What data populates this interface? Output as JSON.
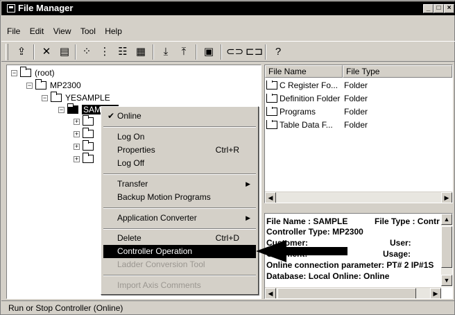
{
  "window": {
    "title": "File Manager"
  },
  "menu": [
    "File",
    "Edit",
    "View",
    "Tool",
    "Help"
  ],
  "toolbar": {
    "tools": [
      {
        "icon": "up-folder-icon"
      },
      {
        "icon": "delete-icon"
      },
      {
        "icon": "properties-icon"
      },
      {
        "icon": "small-icons-icon"
      },
      {
        "icon": "tree-view-icon"
      },
      {
        "icon": "list-view-icon"
      },
      {
        "icon": "details-view-icon"
      },
      {
        "icon": "download-icon"
      },
      {
        "icon": "upload-icon"
      },
      {
        "icon": "save-icon"
      },
      {
        "icon": "connect-icon"
      },
      {
        "icon": "disconnect-icon"
      },
      {
        "icon": "help-icon"
      }
    ]
  },
  "tree": {
    "root": "(root)",
    "controller": "MP2300",
    "project": "YESAMPLE",
    "selected": "SAMPLE"
  },
  "list": {
    "columns": [
      "File Name",
      "File Type"
    ],
    "rows": [
      {
        "name": "C Register Fo...",
        "type": "Folder"
      },
      {
        "name": "Definition Folder",
        "type": "Folder"
      },
      {
        "name": "Programs",
        "type": "Folder"
      },
      {
        "name": "Table Data F...",
        "type": "Folder"
      }
    ]
  },
  "info": {
    "file_name": "File Name : SAMPLE",
    "file_type": "File Type : Contr",
    "controller_type": "Controller Type: MP2300",
    "customer": "Customer:",
    "user": "User:",
    "comment": "Comment:",
    "usage": "Usage:",
    "connection": "Online connection parameter: PT# 2 IP#1S",
    "database": "Database: Local  Online: Online"
  },
  "context_menu": {
    "online": "Online",
    "log_on": "Log On",
    "properties": "Properties",
    "properties_shortcut": "Ctrl+R",
    "log_off": "Log Off",
    "transfer": "Transfer",
    "backup": "Backup Motion Programs",
    "app_converter": "Application Converter",
    "delete": "Delete",
    "delete_shortcut": "Ctrl+D",
    "controller_operation": "Controller Operation",
    "ladder_conversion": "Ladder Conversion Tool",
    "import_axis": "Import Axis Comments"
  },
  "status": {
    "text": "Run or Stop Controller (Online)"
  }
}
